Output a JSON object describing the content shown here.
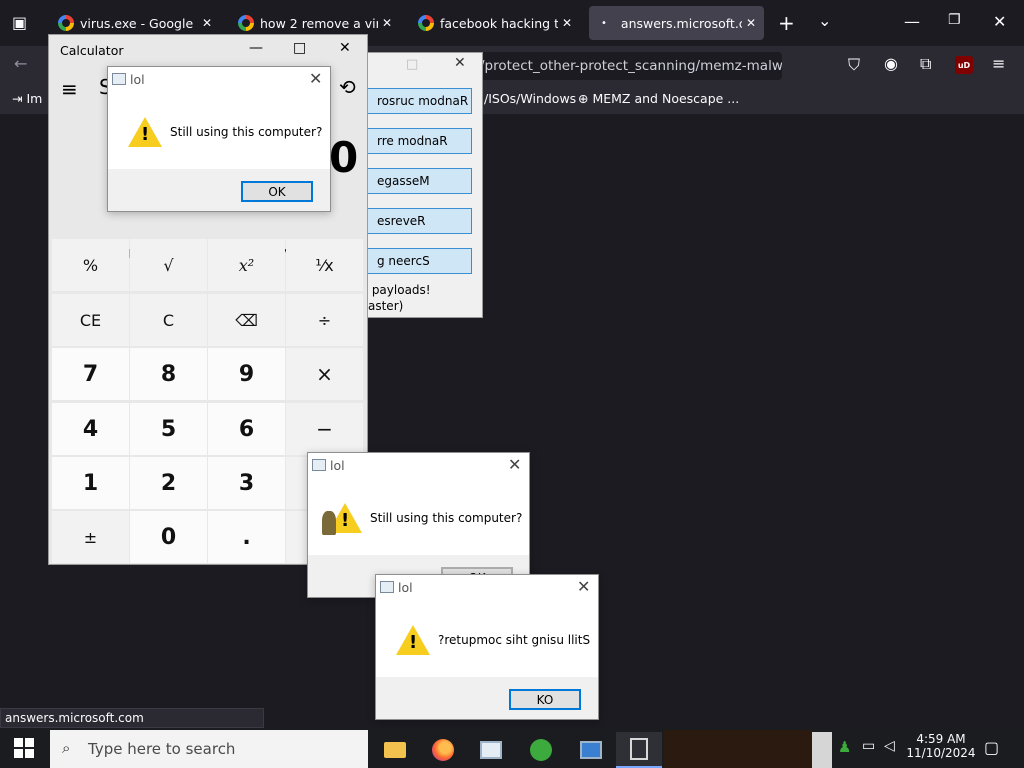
{
  "browser": {
    "tabs": [
      {
        "title": "virus.exe - Google Sear",
        "active": false
      },
      {
        "title": "how 2 remove a virus -",
        "active": false
      },
      {
        "title": "facebook hacking tool",
        "active": false
      },
      {
        "title": "answers.microsoft.com",
        "active": true
      }
    ],
    "url": "/protect_other-protect_scanning/memz-malwar",
    "bookmarks": {
      "first": "Im",
      "iso": "/ISOs/Windows",
      "memz": "MEMZ and Noescape ..."
    },
    "status_text": "answers.microsoft.com",
    "ublock_badge": "uD"
  },
  "calculator": {
    "title": "Calculator",
    "mode_initial": "S",
    "display": "0",
    "memory": [
      "MC",
      "MR",
      "M+",
      "M-",
      "MS",
      "M˅"
    ],
    "keys": [
      [
        "%",
        "√",
        "x²",
        "¹⁄x"
      ],
      [
        "CE",
        "C",
        "⌫",
        "÷"
      ],
      [
        "7",
        "8",
        "9",
        "×"
      ],
      [
        "4",
        "5",
        "6",
        "−"
      ],
      [
        "1",
        "2",
        "3",
        "+"
      ],
      [
        "±",
        "0",
        ".",
        "="
      ]
    ]
  },
  "dialogs": {
    "d1": {
      "title": "lol",
      "message": "Still using this computer?",
      "button": "OK"
    },
    "d2": {
      "title": "lol",
      "message": "Still using this computer?",
      "button": "OK"
    },
    "d3": {
      "title": "lol",
      "message": "?retupmoc siht gnisu llitS",
      "button": "KO"
    }
  },
  "memz": {
    "buttons": [
      "rosruc modnaR",
      "rre modnaR",
      "egasseM",
      "esreveR",
      "g neercS"
    ],
    "text1": " payloads!",
    "text2": "aster)"
  },
  "taskbar": {
    "search_placeholder": "Type here to search",
    "time": "4:59 AM",
    "date": "11/10/2024"
  }
}
